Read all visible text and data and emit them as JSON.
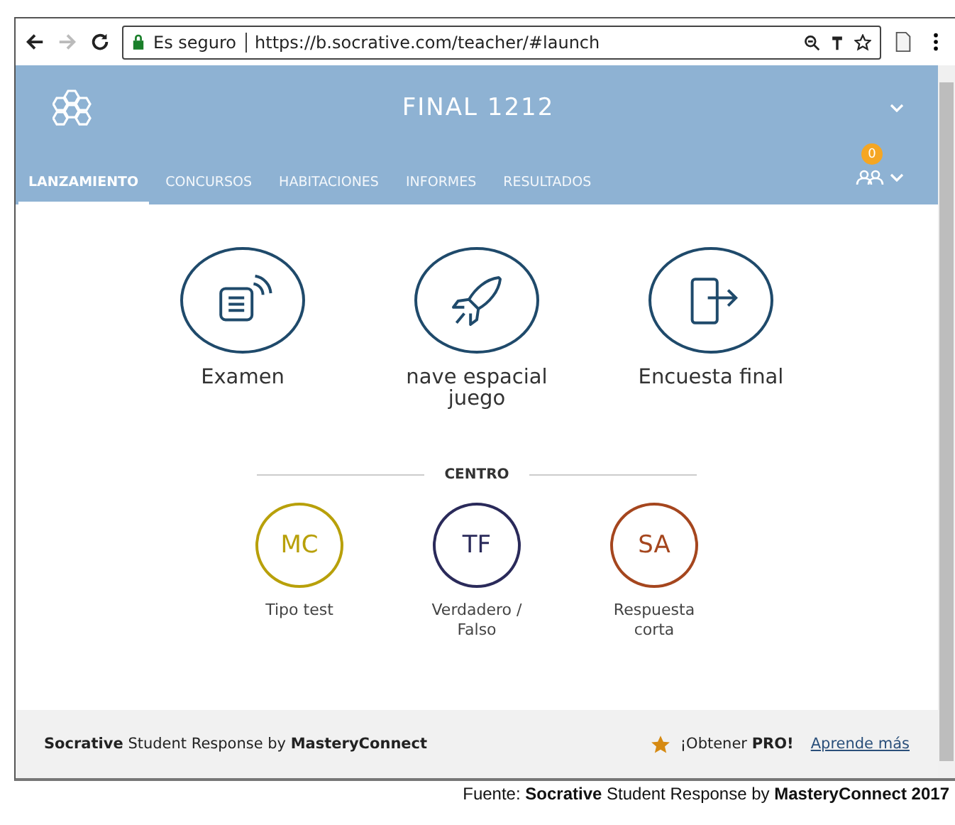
{
  "browser": {
    "secure_label": "Es seguro",
    "url": "https://b.socrative.com/teacher/#launch"
  },
  "header": {
    "title": "FINAL 1212",
    "badge": "0",
    "tabs": [
      {
        "label": "LANZAMIENTO",
        "selected": true
      },
      {
        "label": "CONCURSOS",
        "selected": false
      },
      {
        "label": "HABITACIONES",
        "selected": false
      },
      {
        "label": "INFORMES",
        "selected": false
      },
      {
        "label": "RESULTADOS",
        "selected": false
      }
    ]
  },
  "activities": [
    {
      "kind": "quiz",
      "label": "Examen"
    },
    {
      "kind": "rocket",
      "label": "nave espacial juego"
    },
    {
      "kind": "exit",
      "label": "Encuesta final"
    }
  ],
  "section_title": "CENTRO",
  "quick_questions": [
    {
      "abbr": "MC",
      "label": "Tipo test",
      "color": "#b8a00a"
    },
    {
      "abbr": "TF",
      "label": "Verdadero / Falso",
      "color": "#2a2a5a"
    },
    {
      "abbr": "SA",
      "label": "Respuesta corta",
      "color": "#a5461e"
    }
  ],
  "footer": {
    "brand": "**Socrative** Student Response by **MasteryConnect**",
    "pro": "¡Obtener **PRO!**",
    "link": "Aprende más"
  },
  "caption": "Fuente: **Socrative** Student Response by **MasteryConnect 2017**"
}
